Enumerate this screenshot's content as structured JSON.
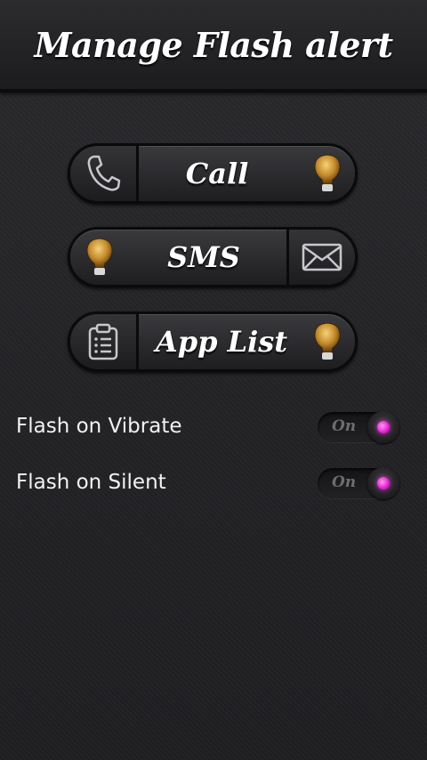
{
  "header": {
    "title": "Manage Flash alert"
  },
  "buttons": [
    {
      "label": "Call",
      "icon": "phone-icon",
      "status_icon": "lightbulb-icon"
    },
    {
      "label": "SMS",
      "icon": "envelope-icon",
      "status_icon": "lightbulb-icon"
    },
    {
      "label": "App List",
      "icon": "clipboard-list-icon",
      "status_icon": "lightbulb-icon"
    }
  ],
  "settings": [
    {
      "label": "Flash on Vibrate",
      "toggle_text": "On"
    },
    {
      "label": "Flash on Silent",
      "toggle_text": "On"
    }
  ],
  "colors": {
    "toggle_indicator": "#e21fd0",
    "bulb": "#d6a645"
  }
}
